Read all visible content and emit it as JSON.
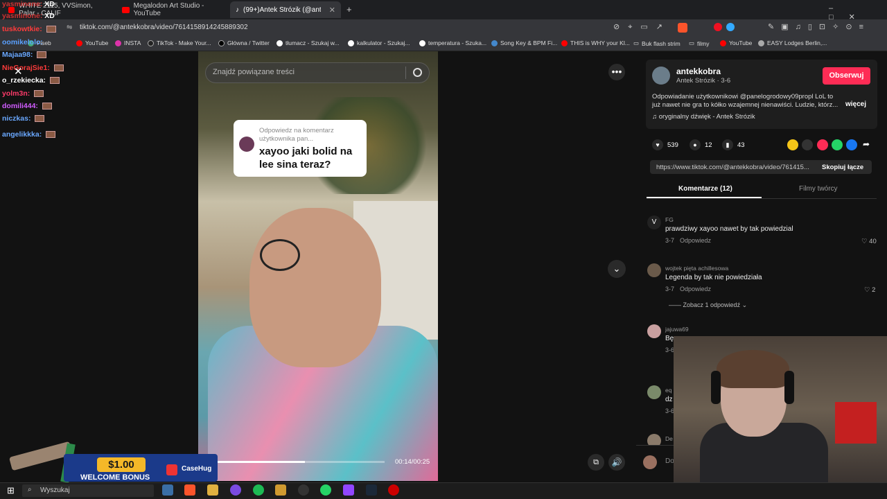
{
  "browser": {
    "tabs": [
      {
        "label": "WHITE 2115, VVSimon, Palar - CALIF"
      },
      {
        "label": "Megalodon Art Studio - YouTube"
      },
      {
        "label": "(99+)Antek Strózik (@antekk"
      }
    ],
    "url": "tiktok.com/@antekkobra/video/7614158914245889302",
    "bookmarks": [
      "Fiseb",
      "YouTube",
      "INSTA",
      "TikTok - Make Your...",
      "Główna / Twitter",
      "tłumacz - Szukaj w...",
      "kalkulator - Szukaj...",
      "temperatura - Szuka...",
      "Song Key & BPM Fi...",
      "THIS is WHY your Kl...",
      "Buk flash strim",
      "filmy",
      "YouTube",
      "EASY Lodges Berlin,..."
    ]
  },
  "chat": [
    {
      "user": "yasminone:",
      "msg": "XD",
      "color": "#cc3333"
    },
    {
      "user": "yasminone:",
      "msg": "XD",
      "color": "#cc3333"
    },
    {
      "user": "tuskowtkie:",
      "msg": "",
      "color": "#ff3b3b"
    },
    {
      "user": "oomikelolo:",
      "msg": "",
      "color": "#5aa0ff"
    },
    {
      "user": "Majaa98:",
      "msg": "",
      "color": "#6aa8ff"
    },
    {
      "user": "NieGorajSie1:",
      "msg": "",
      "color": "#ff3b3b"
    },
    {
      "user": "o_rzekiecka:",
      "msg": "",
      "color": "#ffffff"
    },
    {
      "user": "yolm3n:",
      "msg": "",
      "color": "#ff3b6a"
    },
    {
      "user": "domili444:",
      "msg": "",
      "color": "#d05cff"
    },
    {
      "user": "niczkas:",
      "msg": "",
      "color": "#6aa8ff"
    },
    {
      "user": "angelikkka:",
      "msg": "",
      "color": "#6aa8ff"
    }
  ],
  "video": {
    "search_placeholder": "Znajdź powiązane treści",
    "reply_small": "Odpowiedz na komentarz użytkownika pan...",
    "reply_big": "xayoo jaki bolid na lee sina teraz?",
    "time": "00:14/00:25",
    "progress": 0.53
  },
  "author": {
    "username": "antekkobra",
    "subline": "Antek Strózik · 3-6",
    "follow": "Obserwuj",
    "description": "Odpowiadanie użytkownikowi @panelogrodowy09propl LoL to już nawet nie gra to kółko wzajemnej nienawiści. Ludzie, którz...",
    "more": "więcej",
    "music": "♫  oryginalny dźwięk - Antek Strózik"
  },
  "stats": {
    "likes": "539",
    "comments": "12",
    "saves": "43"
  },
  "link": {
    "url": "https://www.tiktok.com/@antekkobra/video/761415...",
    "copy": "Skopiuj łącze"
  },
  "tabs": {
    "comments": "Komentarze (12)",
    "creator": "Filmy twórcy"
  },
  "comments": [
    {
      "avatar": "V",
      "name": "FG",
      "text": "prawdziwy xayoo nawet by tak powiedzial",
      "date": "3-7",
      "reply": "Odpowiedz",
      "likes": "40"
    },
    {
      "avatar": "",
      "name": "wojtek pięta achillesowa",
      "text": "Legenda by tak nie powiedziała",
      "date": "3-7",
      "reply": "Odpowiedz",
      "likes": "2",
      "more_replies": "Zobacz 1 odpowiedź"
    },
    {
      "avatar": "",
      "name": "jajuwa69",
      "text": "Bę",
      "date": "3-6",
      "reply": "",
      "likes": ""
    },
    {
      "avatar": "",
      "name": "eq",
      "text": "dz",
      "date": "3-6",
      "reply": "",
      "likes": ""
    },
    {
      "avatar": "",
      "name": "De",
      "text": "",
      "date": "",
      "reply": "",
      "likes": ""
    }
  ],
  "comment_placeholder": "Do",
  "bonus": {
    "amount": "$1.00",
    "label": "WELCOME BONUS",
    "brand": "CaseHug"
  },
  "taskbar": {
    "search": "Wyszukaj"
  }
}
